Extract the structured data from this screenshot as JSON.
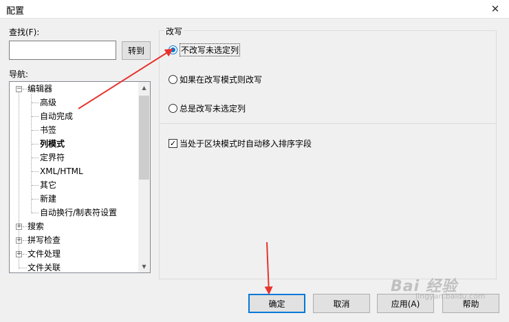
{
  "window": {
    "title": "配置",
    "close": "✕"
  },
  "left": {
    "find_label": "查找(F):",
    "find_value": "",
    "goto_button": "转到",
    "nav_label": "导航:"
  },
  "tree": {
    "editor": "编辑器",
    "children": [
      "高级",
      "自动完成",
      "书签",
      "列模式",
      "定界符",
      "XML/HTML",
      "其它",
      "新建",
      "自动换行/制表符设置"
    ],
    "selected": "列模式",
    "search": "搜索",
    "spellcheck": "拼写检查",
    "file_handling": "文件处理",
    "file_assoc": "文件关联",
    "expand_minus": "−",
    "expand_plus": "+",
    "scroll_up": "▲",
    "scroll_down": "▼"
  },
  "group": {
    "title": "改写",
    "options": [
      {
        "label": "不改写未选定列",
        "checked": true
      },
      {
        "label": "如果在改写模式则改写",
        "checked": false
      },
      {
        "label": "总是改写未选定列",
        "checked": false
      }
    ],
    "checkbox": {
      "label": "当处于区块模式时自动移入排序字段",
      "checked": true,
      "mark": "✓"
    }
  },
  "buttons": {
    "ok": "确定",
    "cancel": "取消",
    "apply": "应用(A)",
    "help": "帮助"
  },
  "watermark": {
    "main": "Bai 经验",
    "sub": "jingyan.baidu.com"
  },
  "colors": {
    "accent": "#0078d7",
    "annotation": "#e8322d"
  }
}
